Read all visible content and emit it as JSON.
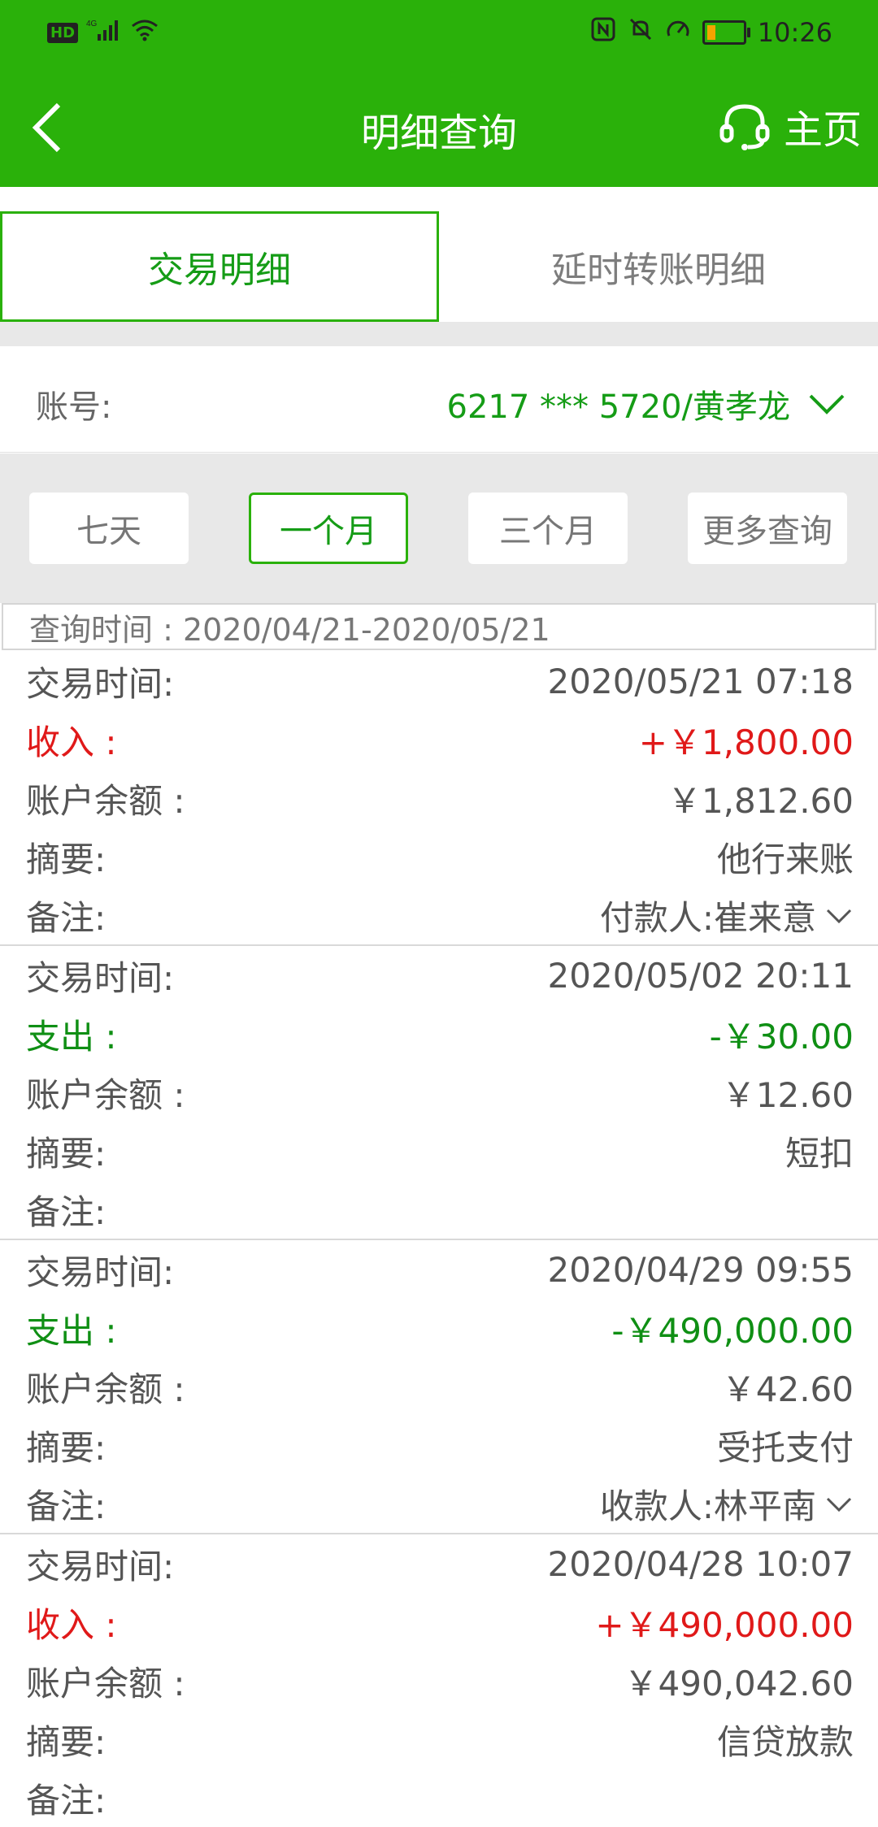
{
  "status_bar": {
    "time": "10:26",
    "left_icons": [
      "hd-icon",
      "4g-signal-icon",
      "wifi-icon"
    ],
    "right_icons": [
      "nfc-icon",
      "mute-icon",
      "speed-icon",
      "battery-icon"
    ]
  },
  "app_bar": {
    "title": "明细查询",
    "home_label": "主页"
  },
  "tabs": [
    {
      "label": "交易明细",
      "active": true
    },
    {
      "label": "延时转账明细",
      "active": false
    }
  ],
  "account": {
    "label": "账号:",
    "value": "6217 *** 5720/黄孝龙"
  },
  "ranges": [
    {
      "label": "七天",
      "active": false
    },
    {
      "label": "一个月",
      "active": true
    },
    {
      "label": "三个月",
      "active": false
    },
    {
      "label": "更多查询",
      "active": false
    }
  ],
  "query_time": "查询时间 : 2020/04/21-2020/05/21",
  "labels": {
    "time": "交易时间:",
    "balance": "账户余额 :",
    "summary": "摘要:",
    "remark": "备注:"
  },
  "records": [
    {
      "time": "2020/05/21 07:18",
      "type_label": "收入 :",
      "amount": "+￥1,800.00",
      "balance": "￥1,812.60",
      "summary": "他行来账",
      "remark": "付款人:崔来意"
    },
    {
      "time": "2020/05/02 20:11",
      "type_label": "支出 :",
      "amount": "-￥30.00",
      "balance": "￥12.60",
      "summary": "短扣",
      "remark": ""
    },
    {
      "time": "2020/04/29 09:55",
      "type_label": "支出 :",
      "amount": "-￥490,000.00",
      "balance": "￥42.60",
      "summary": "受托支付",
      "remark": "收款人:林平南"
    },
    {
      "time": "2020/04/28 10:07",
      "type_label": "收入 :",
      "amount": "+￥490,000.00",
      "balance": "￥490,042.60",
      "summary": "信贷放款",
      "remark": ""
    }
  ],
  "colors": {
    "primary": "#2ab10a",
    "income": "#e01919",
    "expense": "#0f8f14"
  }
}
